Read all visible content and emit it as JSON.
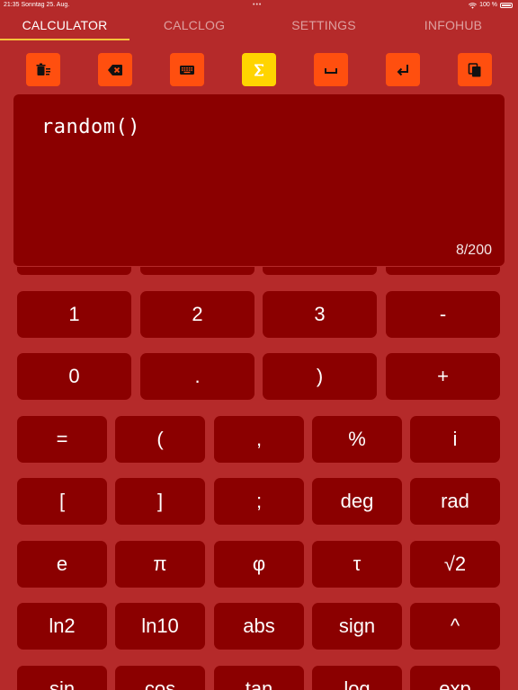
{
  "status": {
    "time": "21:35",
    "date": "Sonntag 25. Aug.",
    "dots": "•••",
    "battery": "100 %"
  },
  "tabs": [
    {
      "label": "CALCULATOR",
      "active": true
    },
    {
      "label": "CALCLOG",
      "active": false
    },
    {
      "label": "SETTINGS",
      "active": false
    },
    {
      "label": "INFOHUB",
      "active": false
    }
  ],
  "toolbar": {
    "buttons": [
      {
        "icon": "clear-all-icon"
      },
      {
        "icon": "backspace-icon"
      },
      {
        "icon": "keyboard-icon"
      },
      {
        "icon": "sigma-icon",
        "active": true
      },
      {
        "icon": "space-icon"
      },
      {
        "icon": "enter-icon"
      },
      {
        "icon": "copy-icon"
      }
    ]
  },
  "display": {
    "expression": "random()",
    "counter": "8/200"
  },
  "keypad": {
    "row1": [
      "1",
      "2",
      "3",
      "-"
    ],
    "row2": [
      "0",
      ".",
      ")",
      "+"
    ],
    "row3": [
      "=",
      "(",
      ",",
      "%",
      "i"
    ],
    "row4": [
      "[",
      "]",
      ";",
      "deg",
      "rad"
    ],
    "row5": [
      "e",
      "π",
      "φ",
      "τ",
      "√2"
    ],
    "row6": [
      "ln2",
      "ln10",
      "abs",
      "sign",
      "^"
    ],
    "row7": [
      "sin",
      "cos",
      "tan",
      "log",
      "exp"
    ]
  },
  "colors": {
    "background": "#B52A2A",
    "panel": "#8B0000",
    "tool_button": "#FF4F0F",
    "tool_button_active": "#FFD400",
    "tab_indicator": "#F5C33B"
  }
}
